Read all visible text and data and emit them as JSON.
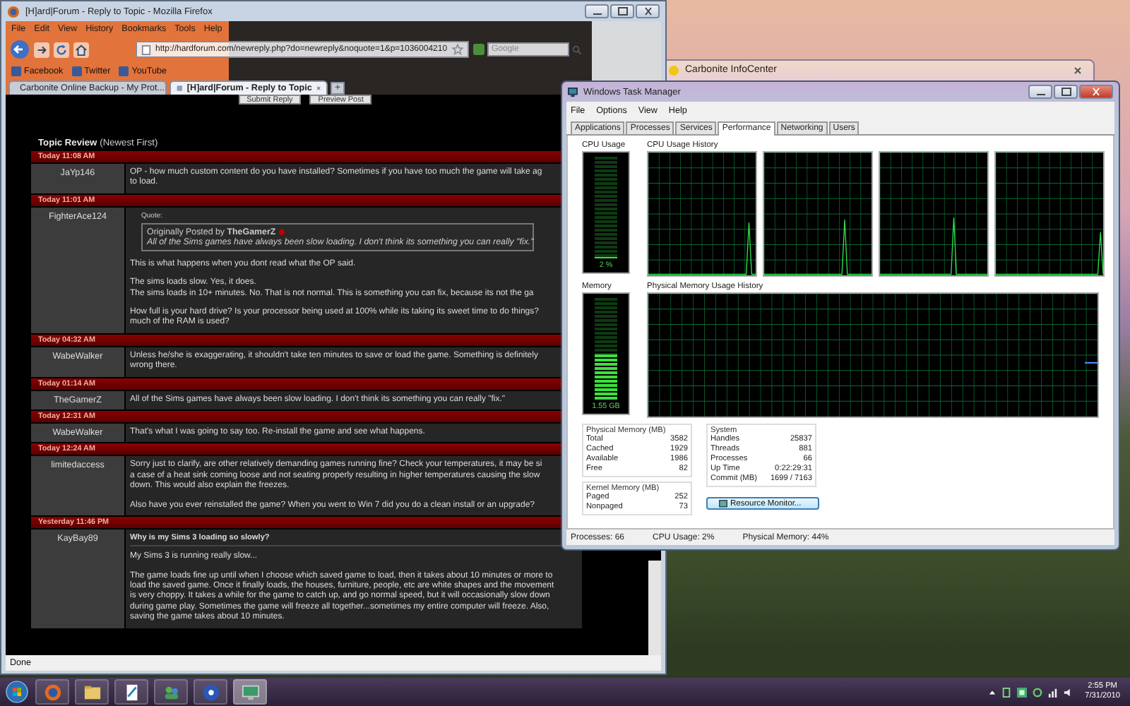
{
  "carbonite": {
    "title": "Carbonite InfoCenter"
  },
  "firefox": {
    "title": "[H]ard|Forum - Reply to Topic - Mozilla Firefox",
    "menu": [
      "File",
      "Edit",
      "View",
      "History",
      "Bookmarks",
      "Tools",
      "Help"
    ],
    "url": "http://hardforum.com/newreply.php?do=newreply&noquote=1&p=1036004210",
    "search_placeholder": "Google",
    "bookmarks": [
      "Facebook",
      "Twitter",
      "YouTube"
    ],
    "tabs": [
      {
        "label": "Carbonite Online Backup - My Prot...",
        "selected": false
      },
      {
        "label": "[H]ard|Forum - Reply to Topic",
        "selected": true
      }
    ],
    "new_tab": "+",
    "buttons": [
      "Submit Reply",
      "Preview Post"
    ],
    "section_title": "Topic Review",
    "section_note": "(Newest First)",
    "posts": [
      {
        "date": "Today 11:08 AM",
        "user": "JaYp146",
        "paragraphs": [
          [
            "OP - how much custom content do you have installed? Sometimes if you have too much the game will take ag",
            "to load."
          ]
        ]
      },
      {
        "date": "Today 11:01 AM",
        "user": "FighterAce124",
        "quote": {
          "label": "Quote:",
          "by": "Originally Posted by **TheGamerZ**",
          "text": "All of the Sims games have always been slow loading. I don't think its something you can really \"fix.\""
        },
        "paragraphs": [
          [
            "This is what happens when you dont read what the OP said."
          ],
          [
            "The sims loads slow. Yes, it does.",
            "The sims loads in 10+ minutes. No. That is not normal. This is something you can fix, because its not the ga"
          ],
          [
            "How full is your hard drive? Is your processor being used at 100% while its taking its sweet time to do things?",
            "much of the RAM is used?"
          ]
        ]
      },
      {
        "date": "Today 04:32 AM",
        "user": "WabeWalker",
        "paragraphs": [
          [
            "Unless he/she is exaggerating, it shouldn't take ten minutes to save or load the game. Something is definitely",
            "wrong there."
          ]
        ]
      },
      {
        "date": "Today 01:14 AM",
        "user": "TheGamerZ",
        "paragraphs": [
          [
            "All of the Sims games have always been slow loading. I don't think its something you can really \"fix.\""
          ]
        ]
      },
      {
        "date": "Today 12:31 AM",
        "user": "WabeWalker",
        "paragraphs": [
          [
            "That's what I was going to say too. Re-install the game and see what happens."
          ]
        ]
      },
      {
        "date": "Today 12:24 AM",
        "user": "limitedaccess",
        "paragraphs": [
          [
            "Sorry just to clarify, are other relatively demanding games running fine? Check your temperatures, it may be si",
            "a case of a heat sink coming loose and not seating properly resulting in higher temperatures causing the slow",
            "down. This would also explain the freezes."
          ],
          [
            "Also have you ever reinstalled the game? When you went to Win 7 did you do a clean install or an upgrade?"
          ]
        ]
      },
      {
        "date": "Yesterday 11:46 PM",
        "user": "KayBay89",
        "title": "Why is my Sims 3 loading so slowly?",
        "paragraphs": [
          [
            "My Sims 3 is running really slow..."
          ],
          [
            "The game loads fine up until when I choose which saved game to load, then it takes about 10 minutes or more to",
            "load the saved game. Once it finally loads, the houses, furniture, people, etc are white shapes and the movement",
            "is very choppy. It takes a while for the game to catch up, and go normal speed, but it will occasionally slow down",
            "during game play. Sometimes the game will freeze all together...sometimes my entire computer will freeze. Also,",
            "saving the game takes about 10 minutes."
          ]
        ]
      }
    ],
    "status": "Done"
  },
  "task_manager": {
    "title": "Windows Task Manager",
    "menu": [
      "File",
      "Options",
      "View",
      "Help"
    ],
    "tabs": [
      {
        "label": "Applications",
        "selected": false
      },
      {
        "label": "Processes",
        "selected": false
      },
      {
        "label": "Services",
        "selected": false
      },
      {
        "label": "Performance",
        "selected": true
      },
      {
        "label": "Networking",
        "selected": false
      },
      {
        "label": "Users",
        "selected": false
      }
    ],
    "cpu": {
      "label": "CPU Usage",
      "reading": "2 %",
      "level": 0.02
    },
    "cpu_history": {
      "label": "CPU Usage History"
    },
    "memory": {
      "label": "Memory",
      "reading": "1.55 GB",
      "level": 0.44
    },
    "memory_history": {
      "label": "Physical Memory Usage History"
    },
    "physical_memory": {
      "title": "Physical Memory (MB)",
      "rows": [
        {
          "name": "Total",
          "value": "3582"
        },
        {
          "name": "Cached",
          "value": "1929"
        },
        {
          "name": "Available",
          "value": "1986"
        },
        {
          "name": "Free",
          "value": "82"
        }
      ]
    },
    "kernel_memory": {
      "title": "Kernel Memory (MB)",
      "rows": [
        {
          "name": "Paged",
          "value": "252"
        },
        {
          "name": "Nonpaged",
          "value": "73"
        }
      ]
    },
    "system": {
      "title": "System",
      "rows": [
        {
          "name": "Handles",
          "value": "25837"
        },
        {
          "name": "Threads",
          "value": "881"
        },
        {
          "name": "Processes",
          "value": "66"
        },
        {
          "name": "Up Time",
          "value": "0:22:29:31"
        },
        {
          "name": "Commit (MB)",
          "value": "1699 / 7163"
        }
      ]
    },
    "button": "Resource Monitor...",
    "status": [
      "Processes: 66",
      "CPU Usage: 2%",
      "Physical Memory: 44%"
    ]
  },
  "taskbar": {
    "apps": [
      {
        "kind": "browser",
        "selected": false
      },
      {
        "kind": "folder",
        "selected": false
      },
      {
        "kind": "document",
        "selected": false
      },
      {
        "kind": "people",
        "selected": false
      },
      {
        "kind": "media",
        "selected": false
      },
      {
        "kind": "monitor",
        "selected": true
      }
    ],
    "clock_time": "2:55 PM",
    "clock_date": "7/31/2010"
  }
}
